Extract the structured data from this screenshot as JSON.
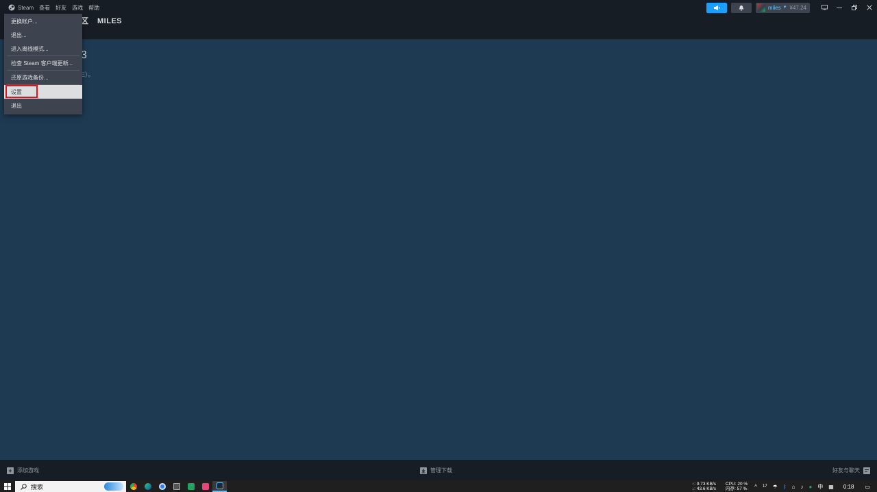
{
  "menubar": {
    "items": [
      "Steam",
      "查看",
      "好友",
      "游戏",
      "帮助"
    ]
  },
  "titlebar": {
    "account_name": "miles",
    "balance": "¥47.24"
  },
  "nav": {
    "partial_label": "区",
    "profile_label": "MILES"
  },
  "main": {
    "partial_heading": "3",
    "partial_sub": "E）。"
  },
  "dropdown": {
    "items": [
      "更换帐户...",
      "退出...",
      "进入离线模式...",
      "检查 Steam 客户端更新...",
      "还原游戏备份...",
      "设置",
      "退出"
    ],
    "highlighted": "设置"
  },
  "statusbar": {
    "add_game": "添加游戏",
    "manage_downloads": "管理下载",
    "friends_chat": "好友与聊天"
  },
  "taskbar": {
    "search_placeholder": "搜索",
    "net_up": "↑: 9.73 KB/s",
    "net_down": "↓: 43.6 KB/s",
    "cpu": "CPU: 20 %",
    "mem": "内存: 57 %",
    "temp": "17",
    "ime": "中",
    "time": "0:18"
  },
  "colors": {
    "accent": "#1a9fff",
    "highlight_border": "#e0141e",
    "main_bg": "#1e3a52"
  }
}
